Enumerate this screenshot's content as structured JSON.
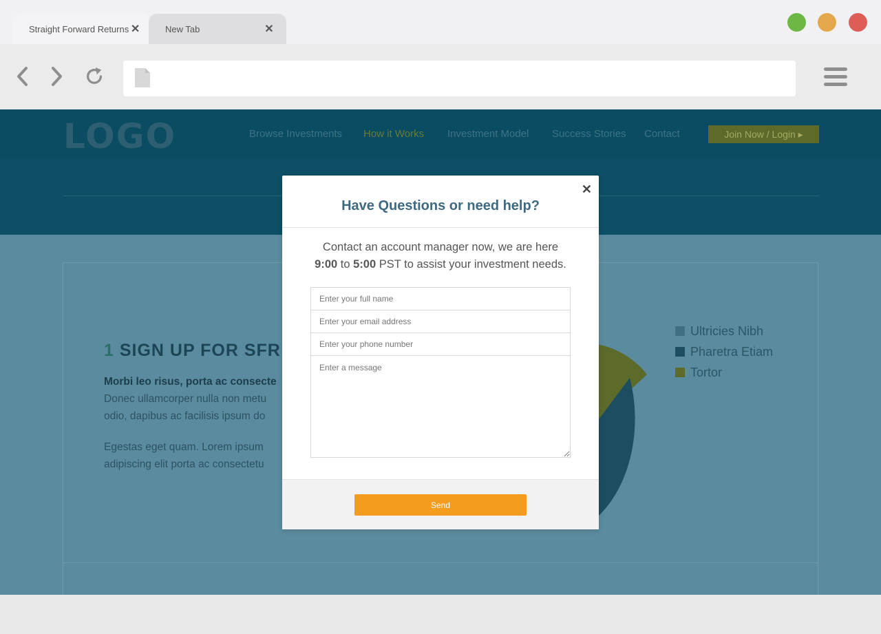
{
  "browser": {
    "tabs": [
      {
        "label": "Straight Forward Returns",
        "active": true
      },
      {
        "label": "New Tab",
        "active": false
      }
    ],
    "tab_close_glyph": "✕",
    "window_controls": {
      "green": "#6db845",
      "yellow": "#e3a84b",
      "red": "#de5d56"
    },
    "address_value": ""
  },
  "site": {
    "logo": "LOGO",
    "nav": [
      "Browse Investments",
      "How it Works",
      "Investment Model",
      "Success Stories",
      "Contact"
    ],
    "join_label": "Join Now / Login ▸",
    "section_number": "1",
    "section_title": "SIGN UP FOR SFR",
    "para1_bold": "Morbi leo risus, porta ac consecte",
    "para1_rest": "Donec ullamcorper nulla non metu odio, dapibus ac facilisis ipsum do",
    "para2": "Egestas eget quam. Lorem ipsum adipiscing elit porta ac consectetu",
    "legend": [
      {
        "label": "Ultricies Nibh",
        "color": "#3f6f80"
      },
      {
        "label": "Pharetra Etiam",
        "color": "#1d4d60"
      },
      {
        "label": "Tortor",
        "color": "#5c6a2a"
      }
    ]
  },
  "modal": {
    "close_glyph": "✕",
    "title": "Have Questions or need help?",
    "text_line1": "Contact an account manager now, we are here",
    "hours_start": "9:00",
    "hours_to": "to",
    "hours_end": "5:00",
    "text_line2_rest": "PST to assist your investment needs.",
    "fields": {
      "name_placeholder": "Enter your full name",
      "email_placeholder": "Enter your email address",
      "phone_placeholder": "Enter your phone number",
      "message_placeholder": "Enter a message"
    },
    "send_label": "Send",
    "accent_color": "#f39c1e"
  }
}
